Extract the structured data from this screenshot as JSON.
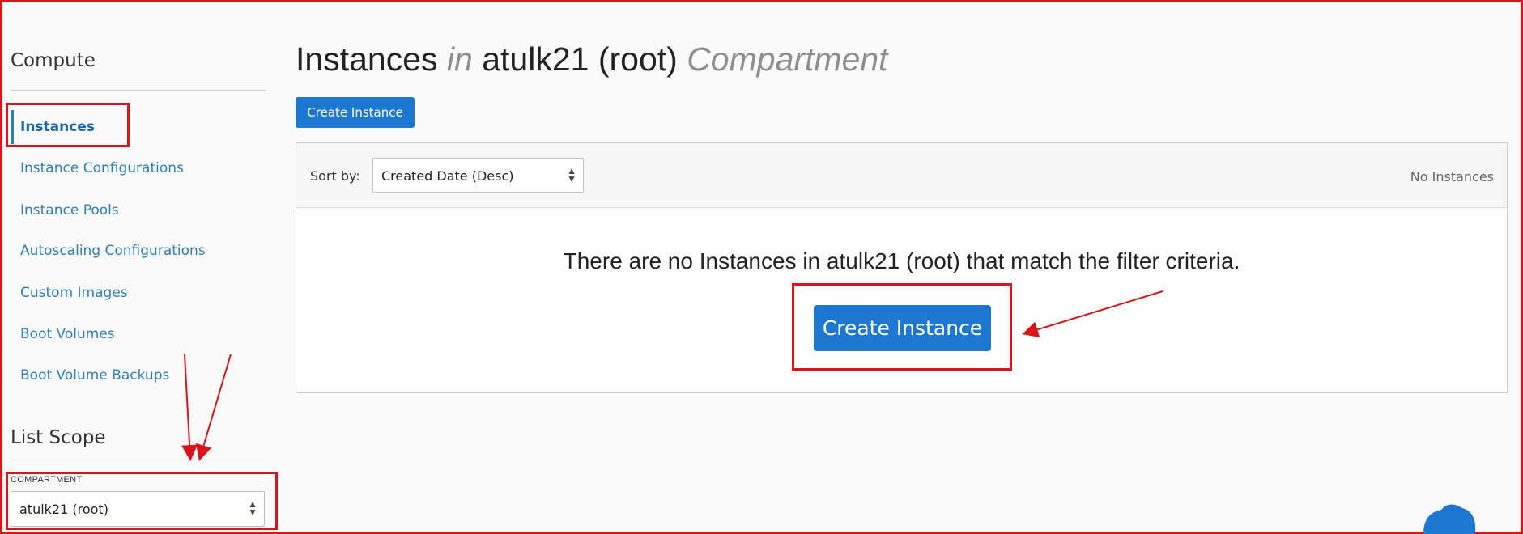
{
  "sidebar": {
    "section_title": "Compute",
    "items": [
      {
        "label": "Instances",
        "active": true
      },
      {
        "label": "Instance Configurations"
      },
      {
        "label": "Instance Pools"
      },
      {
        "label": "Autoscaling Configurations"
      },
      {
        "label": "Custom Images"
      },
      {
        "label": "Boot Volumes"
      },
      {
        "label": "Boot Volume Backups"
      }
    ],
    "list_scope_title": "List Scope",
    "compartment": {
      "label": "COMPARTMENT",
      "value": "atulk21 (root)"
    }
  },
  "header": {
    "title_part1": "Instances",
    "title_in": "in",
    "title_part2": "atulk21 (root)",
    "title_part3": "Compartment"
  },
  "toolbar": {
    "create_label": "Create Instance"
  },
  "list": {
    "sort_label": "Sort by:",
    "sort_value": "Created Date (Desc)",
    "count_label": "No Instances",
    "empty_message": "There are no Instances in atulk21 (root) that match the filter criteria.",
    "empty_create_label": "Create Instance"
  },
  "colors": {
    "accent": "#1d76d0",
    "link": "#2f7eb6",
    "annotation": "#d9151b"
  }
}
